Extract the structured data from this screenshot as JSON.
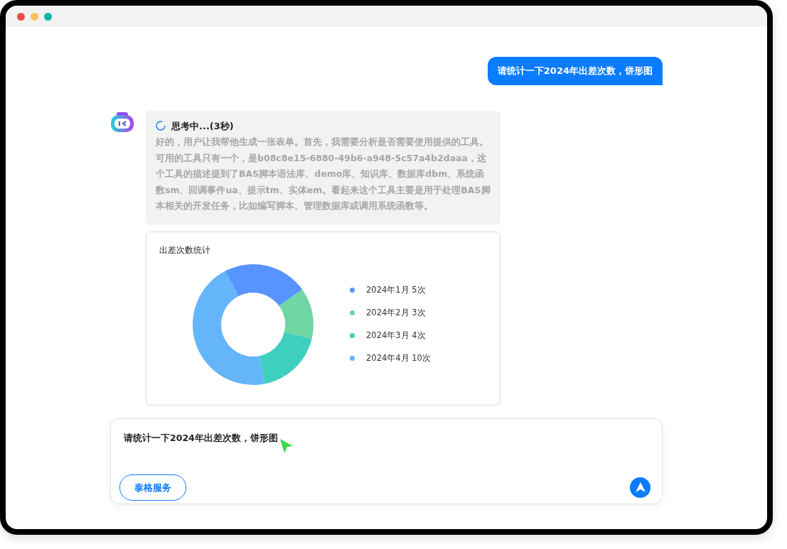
{
  "window": {
    "controls": [
      {
        "color": "#ee4b4b"
      },
      {
        "color": "#fdc25e"
      },
      {
        "color": "#15b5a5"
      }
    ]
  },
  "user_message": "请统计一下2024年出差次数，饼形图",
  "assistant": {
    "thinking": {
      "status": "思考中...(3秒)",
      "text": "好的，用户让我帮他生成一张表单。首先，我需要分析是否需要使用提供的工具。可用的工具只有一个，是b08c8e15-6880-49b6-a948-5c57a4b2daaa，这个工具的描述提到了BAS脚本语法库、demo库、知识库、数据库dbm、系统函数sm、回调事件ua、提示tm、实体em。看起来这个工具主要是用于处理BAS脚本相关的开发任务，比如编写脚本、管理数据库或调用系统函数等。"
    },
    "chart_card": {
      "chart_data": {
        "type": "donut",
        "title": "出差次数统计",
        "categories": [
          "2024年1月 5次",
          "2024年2月 3次",
          "2024年3月 4次",
          "2024年4月 10次"
        ],
        "values": [
          5,
          3,
          4,
          10
        ],
        "colors": [
          "#5794ff",
          "#6fd6a4",
          "#3ecfbf",
          "#64b5fa"
        ]
      }
    }
  },
  "composer": {
    "value": "请统计一下2024年出差次数，饼形图",
    "service_button": "泰格服务"
  }
}
